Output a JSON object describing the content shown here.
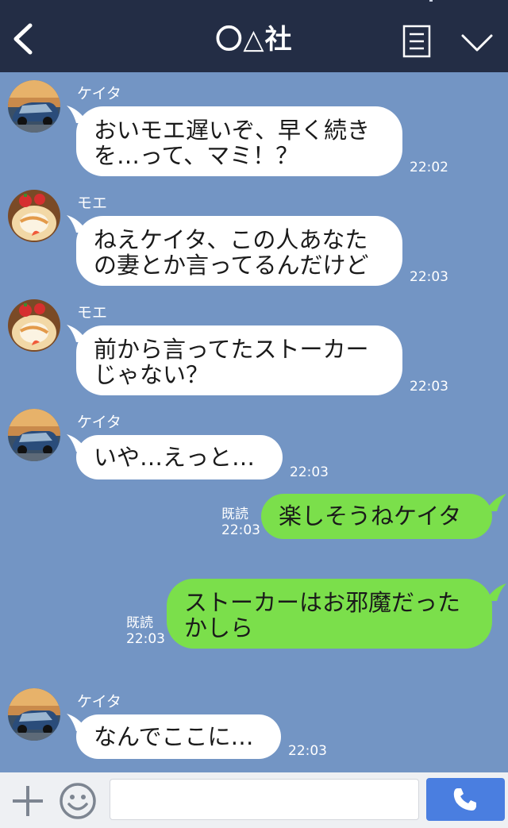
{
  "header": {
    "title": "〇△社",
    "icons": [
      "chevron-left-icon",
      "menu-icon",
      "chevron-down-icon"
    ]
  },
  "messages": [
    {
      "sender": "ケイタ",
      "direction": "in",
      "line1": "おいモエ遅いぞ、早く続き",
      "line2": "を…って、マミ！？",
      "time": "22:02"
    },
    {
      "sender": "モエ",
      "direction": "in",
      "line1": "ねえケイタ、この人あなた",
      "line2": "の妻とか言ってるんだけど",
      "time": "22:03"
    },
    {
      "sender": "モエ",
      "direction": "in",
      "line1": "前から言ってたストーカー",
      "line2": "じゃない？",
      "time": "22:03"
    },
    {
      "sender": "ケイタ",
      "direction": "in",
      "line1": "いや…えっと…",
      "time": "22:03"
    },
    {
      "direction": "out",
      "line1": "楽しそうねケイタ",
      "read": "既読",
      "time": "22:03"
    },
    {
      "direction": "out",
      "line1": "ストーカーはお邪魔だった",
      "line2": "かしら",
      "read": "既読",
      "time": "22:03"
    },
    {
      "sender": "ケイタ",
      "direction": "in",
      "line1": "なんでここに…",
      "time": "22:03"
    }
  ],
  "footer": {
    "icons": [
      "plus-icon",
      "smiley-icon",
      "phone-icon"
    ],
    "input_value": ""
  },
  "colors": {
    "header_bg": "#232d45",
    "chat_bg": "#7395c4",
    "incoming_bubble": "#ffffff",
    "outgoing_bubble": "#7bdf4b",
    "call_button": "#4a7ee0"
  }
}
